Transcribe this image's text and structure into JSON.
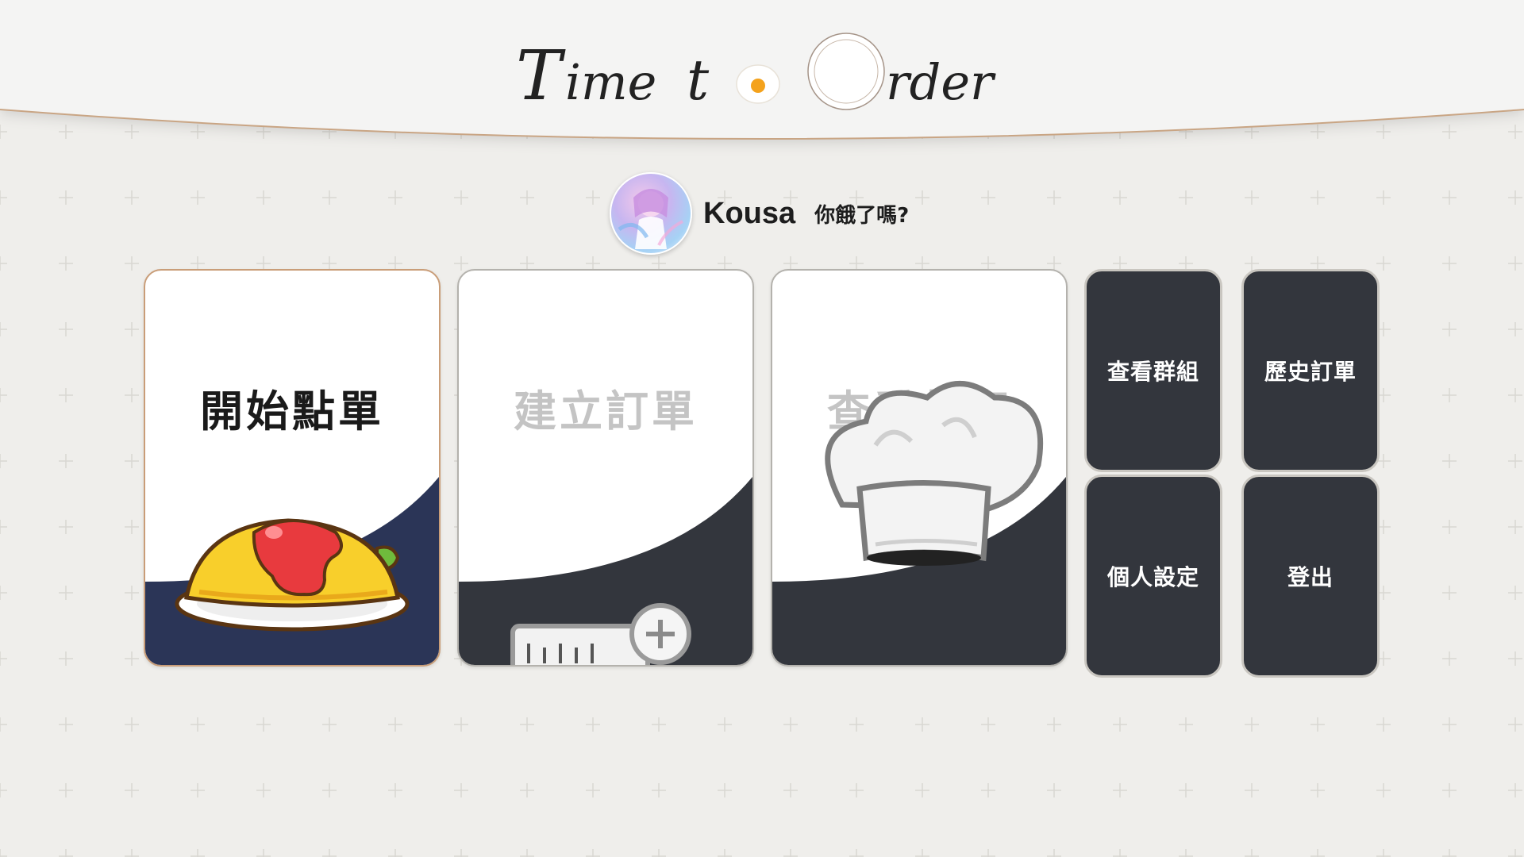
{
  "app": {
    "logo_title": "Time to Order",
    "brand_colors": {
      "navy": "#2b3557",
      "charcoal": "#33363d",
      "accent_border": "#c99d78",
      "background": "#efeeeb"
    }
  },
  "greeting": {
    "username": "Kousa",
    "question": "你餓了嗎?"
  },
  "cards": {
    "start_order": {
      "label": "開始點單",
      "icon": "omelette-rice-icon"
    },
    "create_order": {
      "label": "建立訂單",
      "icon": "add-calculator-icon"
    },
    "view_restaurant": {
      "label": "查看餐廳",
      "icon": "chef-hat-icon"
    }
  },
  "tiles": {
    "groups": "查看群組",
    "history": "歷史訂單",
    "profile": "個人設定",
    "logout": "登出"
  }
}
